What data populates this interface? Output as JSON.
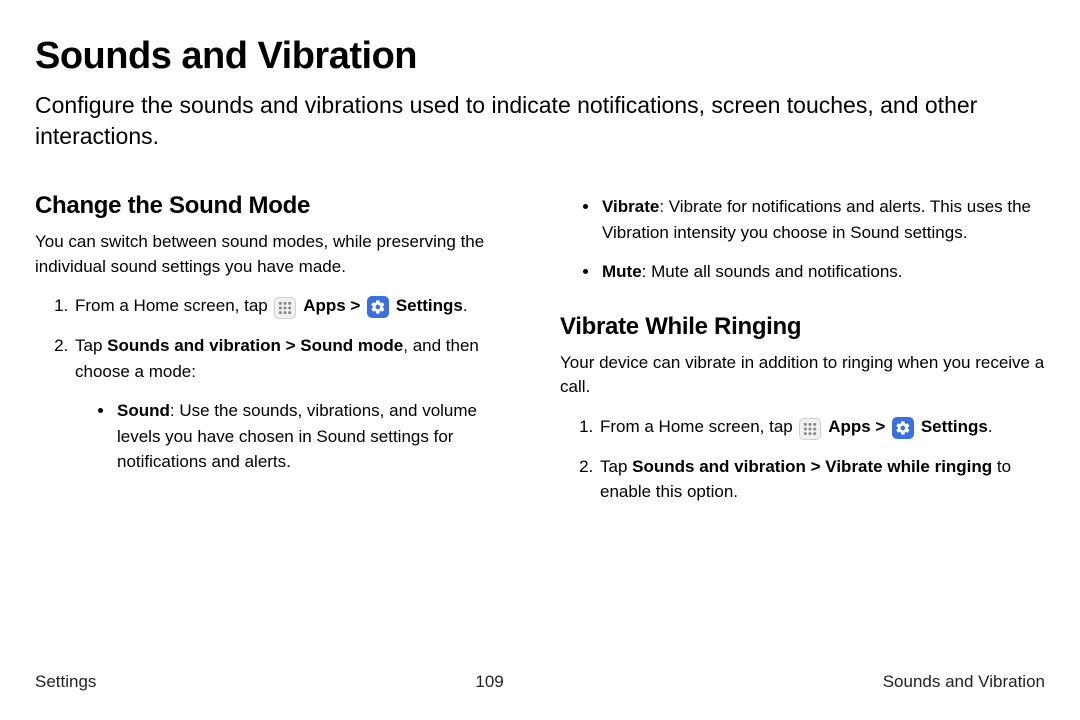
{
  "page": {
    "title": "Sounds and Vibration",
    "intro": "Configure the sounds and vibrations used to indicate notifications, screen touches, and other interactions."
  },
  "section1": {
    "heading": "Change the Sound Mode",
    "intro": "You can switch between sound modes, while preserving the individual sound settings you have made.",
    "step1_pre": "From a Home screen, tap ",
    "apps_label": "Apps",
    "sep": " > ",
    "settings_label": "Settings",
    "step1_post": ".",
    "step2_pre": "Tap ",
    "step2_bold": "Sounds and vibration > Sound mode",
    "step2_post": ", and then choose a mode:",
    "bullet_sound_label": "Sound",
    "bullet_sound_text": ": Use the sounds, vibrations, and volume levels you have chosen in Sound settings for notifications and alerts.",
    "bullet_vibrate_label": "Vibrate",
    "bullet_vibrate_text": ": Vibrate for notifications and alerts. This uses the Vibration intensity you choose in Sound settings.",
    "bullet_mute_label": "Mute",
    "bullet_mute_text": ": Mute all sounds and notifications."
  },
  "section2": {
    "heading": "Vibrate While Ringing",
    "intro": "Your device can vibrate in addition to ringing when you receive a call.",
    "step1_pre": "From a Home screen, tap ",
    "apps_label": "Apps",
    "sep": " > ",
    "settings_label": "Settings",
    "step1_post": ".",
    "step2_pre": "Tap ",
    "step2_bold": "Sounds and vibration > Vibrate while ringing",
    "step2_post": " to enable this option."
  },
  "footer": {
    "left": "Settings",
    "center": "109",
    "right": "Sounds and Vibration"
  }
}
